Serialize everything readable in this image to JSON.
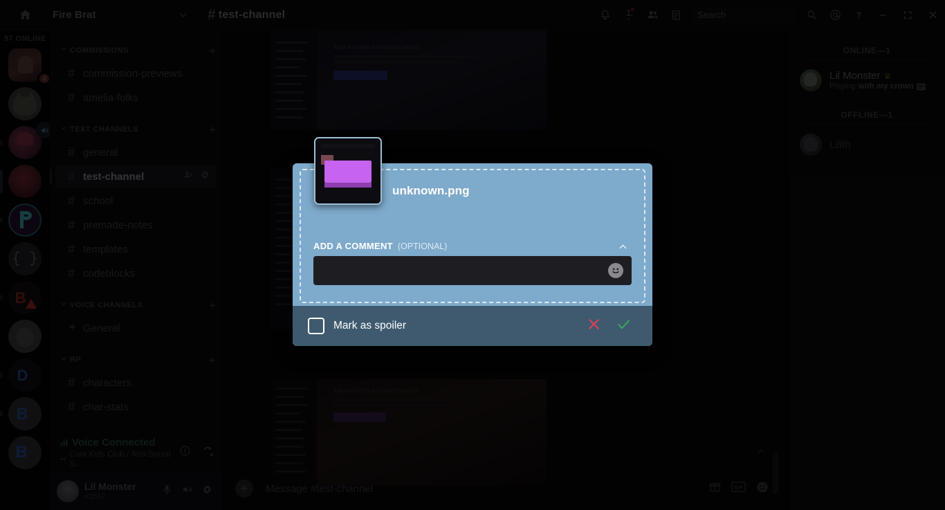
{
  "titlebar": {
    "home_icon": "home-icon",
    "guild_name": "Fire Brat",
    "channel_hash": "#",
    "channel_name": "test-channel",
    "icons": [
      "notifications-bell-icon",
      "pinned-messages-icon",
      "members-icon",
      "inbox-icon"
    ],
    "search_placeholder": "Search",
    "right_icons": [
      "search-icon",
      "mentions-icon",
      "help-icon"
    ],
    "window_controls": [
      "minimize",
      "maximize",
      "close"
    ]
  },
  "rail": {
    "online_label": "57 ONLINE",
    "guilds": [
      {
        "name": "guild-avatar-1",
        "badge": "4"
      },
      {
        "name": "guild-avatar-cat"
      },
      {
        "name": "guild-avatar-girl",
        "muted": true
      },
      {
        "name": "guild-avatar-red"
      },
      {
        "name": "guild-avatar-p"
      },
      {
        "name": "guild-avatar-braces"
      },
      {
        "name": "guild-avatar-b-red"
      },
      {
        "name": "guild-avatar-bunny"
      },
      {
        "name": "guild-avatar-blue-d"
      },
      {
        "name": "guild-avatar-blue-b"
      },
      {
        "name": "guild-avatar-blue-b2"
      }
    ]
  },
  "sidebar": {
    "categories": [
      {
        "label": "COMMISSIONS",
        "plus": "+",
        "channels": [
          {
            "name": "commission-previews",
            "type": "text"
          },
          {
            "name": "amelia-folks",
            "type": "text"
          }
        ]
      },
      {
        "label": "TEXT CHANNELS",
        "plus": "+",
        "channels": [
          {
            "name": "general",
            "type": "text"
          },
          {
            "name": "test-channel",
            "type": "text",
            "active": true
          },
          {
            "name": "school",
            "type": "text"
          },
          {
            "name": "premade-notes",
            "type": "text"
          },
          {
            "name": "templates",
            "type": "text"
          },
          {
            "name": "codeblocks",
            "type": "text"
          }
        ]
      },
      {
        "label": "VOICE CHANNELS",
        "plus": "+",
        "channels": [
          {
            "name": "General",
            "type": "voice"
          }
        ]
      },
      {
        "label": "RP",
        "plus": "+",
        "channels": [
          {
            "name": "characters",
            "type": "text"
          },
          {
            "name": "char-stats",
            "type": "text"
          }
        ]
      }
    ],
    "voice_panel": {
      "status": "Voice Connected",
      "location": "Cool Kids Club / Anti-Social S...",
      "info_icon": "info-icon",
      "disconnect_icon": "disconnect-call-icon"
    },
    "user_panel": {
      "username": "Lil Monster",
      "discriminator": "#3557",
      "mic_icon": "microphone-icon",
      "deafen_icon": "headphones-icon",
      "settings_icon": "gear-icon"
    }
  },
  "main": {
    "composer_placeholder": "Message #test-channel",
    "composer_icons": [
      "gift-icon",
      "gif-icon",
      "emoji-icon"
    ],
    "attachment_caption": "TWO-FACTOR AUTHENTICATION"
  },
  "members": {
    "online_header": "ONLINE—1",
    "offline_header": "OFFLINE—1",
    "online": [
      {
        "name": "Lil Monster",
        "badge_icon": "crown-icon",
        "badge_glyph": "♛",
        "status_prefix": "Playing",
        "status_game": "with my crown",
        "status_icon": "rich-presence-icon"
      }
    ],
    "offline": [
      {
        "name": "Lilith"
      }
    ]
  },
  "modal": {
    "file_name": "unknown.png",
    "thumbnail_name": "upload-thumbnail",
    "comment_label": "ADD A COMMENT",
    "comment_optional": "(OPTIONAL)",
    "comment_value": "",
    "collapse_icon": "chevron-up-icon",
    "emoji_icon": "emoji-icon",
    "spoiler_label": "Mark as spoiler",
    "spoiler_checked": false,
    "cancel_icon": "cancel-x-icon",
    "confirm_icon": "confirm-check-icon",
    "colors": {
      "body": "#7eaacb",
      "footer": "#3f5a6e",
      "cancel": "#e0405a",
      "confirm": "#3ba55d",
      "input": "#1e1e22"
    }
  }
}
